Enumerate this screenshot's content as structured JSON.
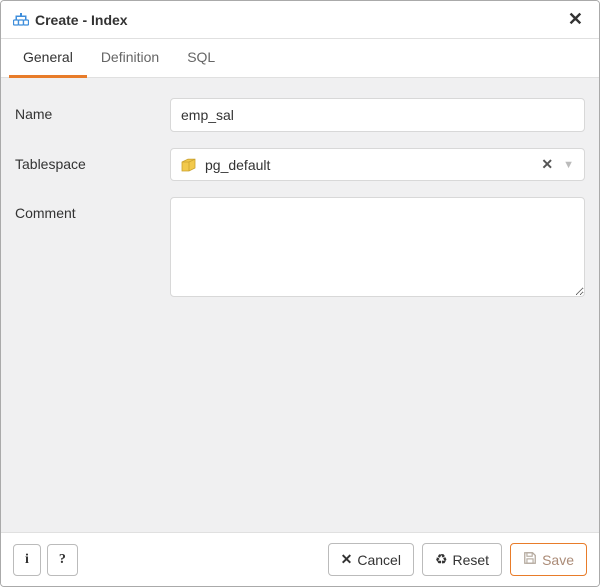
{
  "header": {
    "title": "Create - Index"
  },
  "tabs": {
    "general": "General",
    "definition": "Definition",
    "sql": "SQL"
  },
  "form": {
    "name_label": "Name",
    "name_value": "emp_sal",
    "tablespace_label": "Tablespace",
    "tablespace_value": "pg_default",
    "comment_label": "Comment",
    "comment_value": ""
  },
  "footer": {
    "info_label": "i",
    "help_label": "?",
    "cancel_label": "Cancel",
    "reset_label": "Reset",
    "save_label": "Save"
  }
}
